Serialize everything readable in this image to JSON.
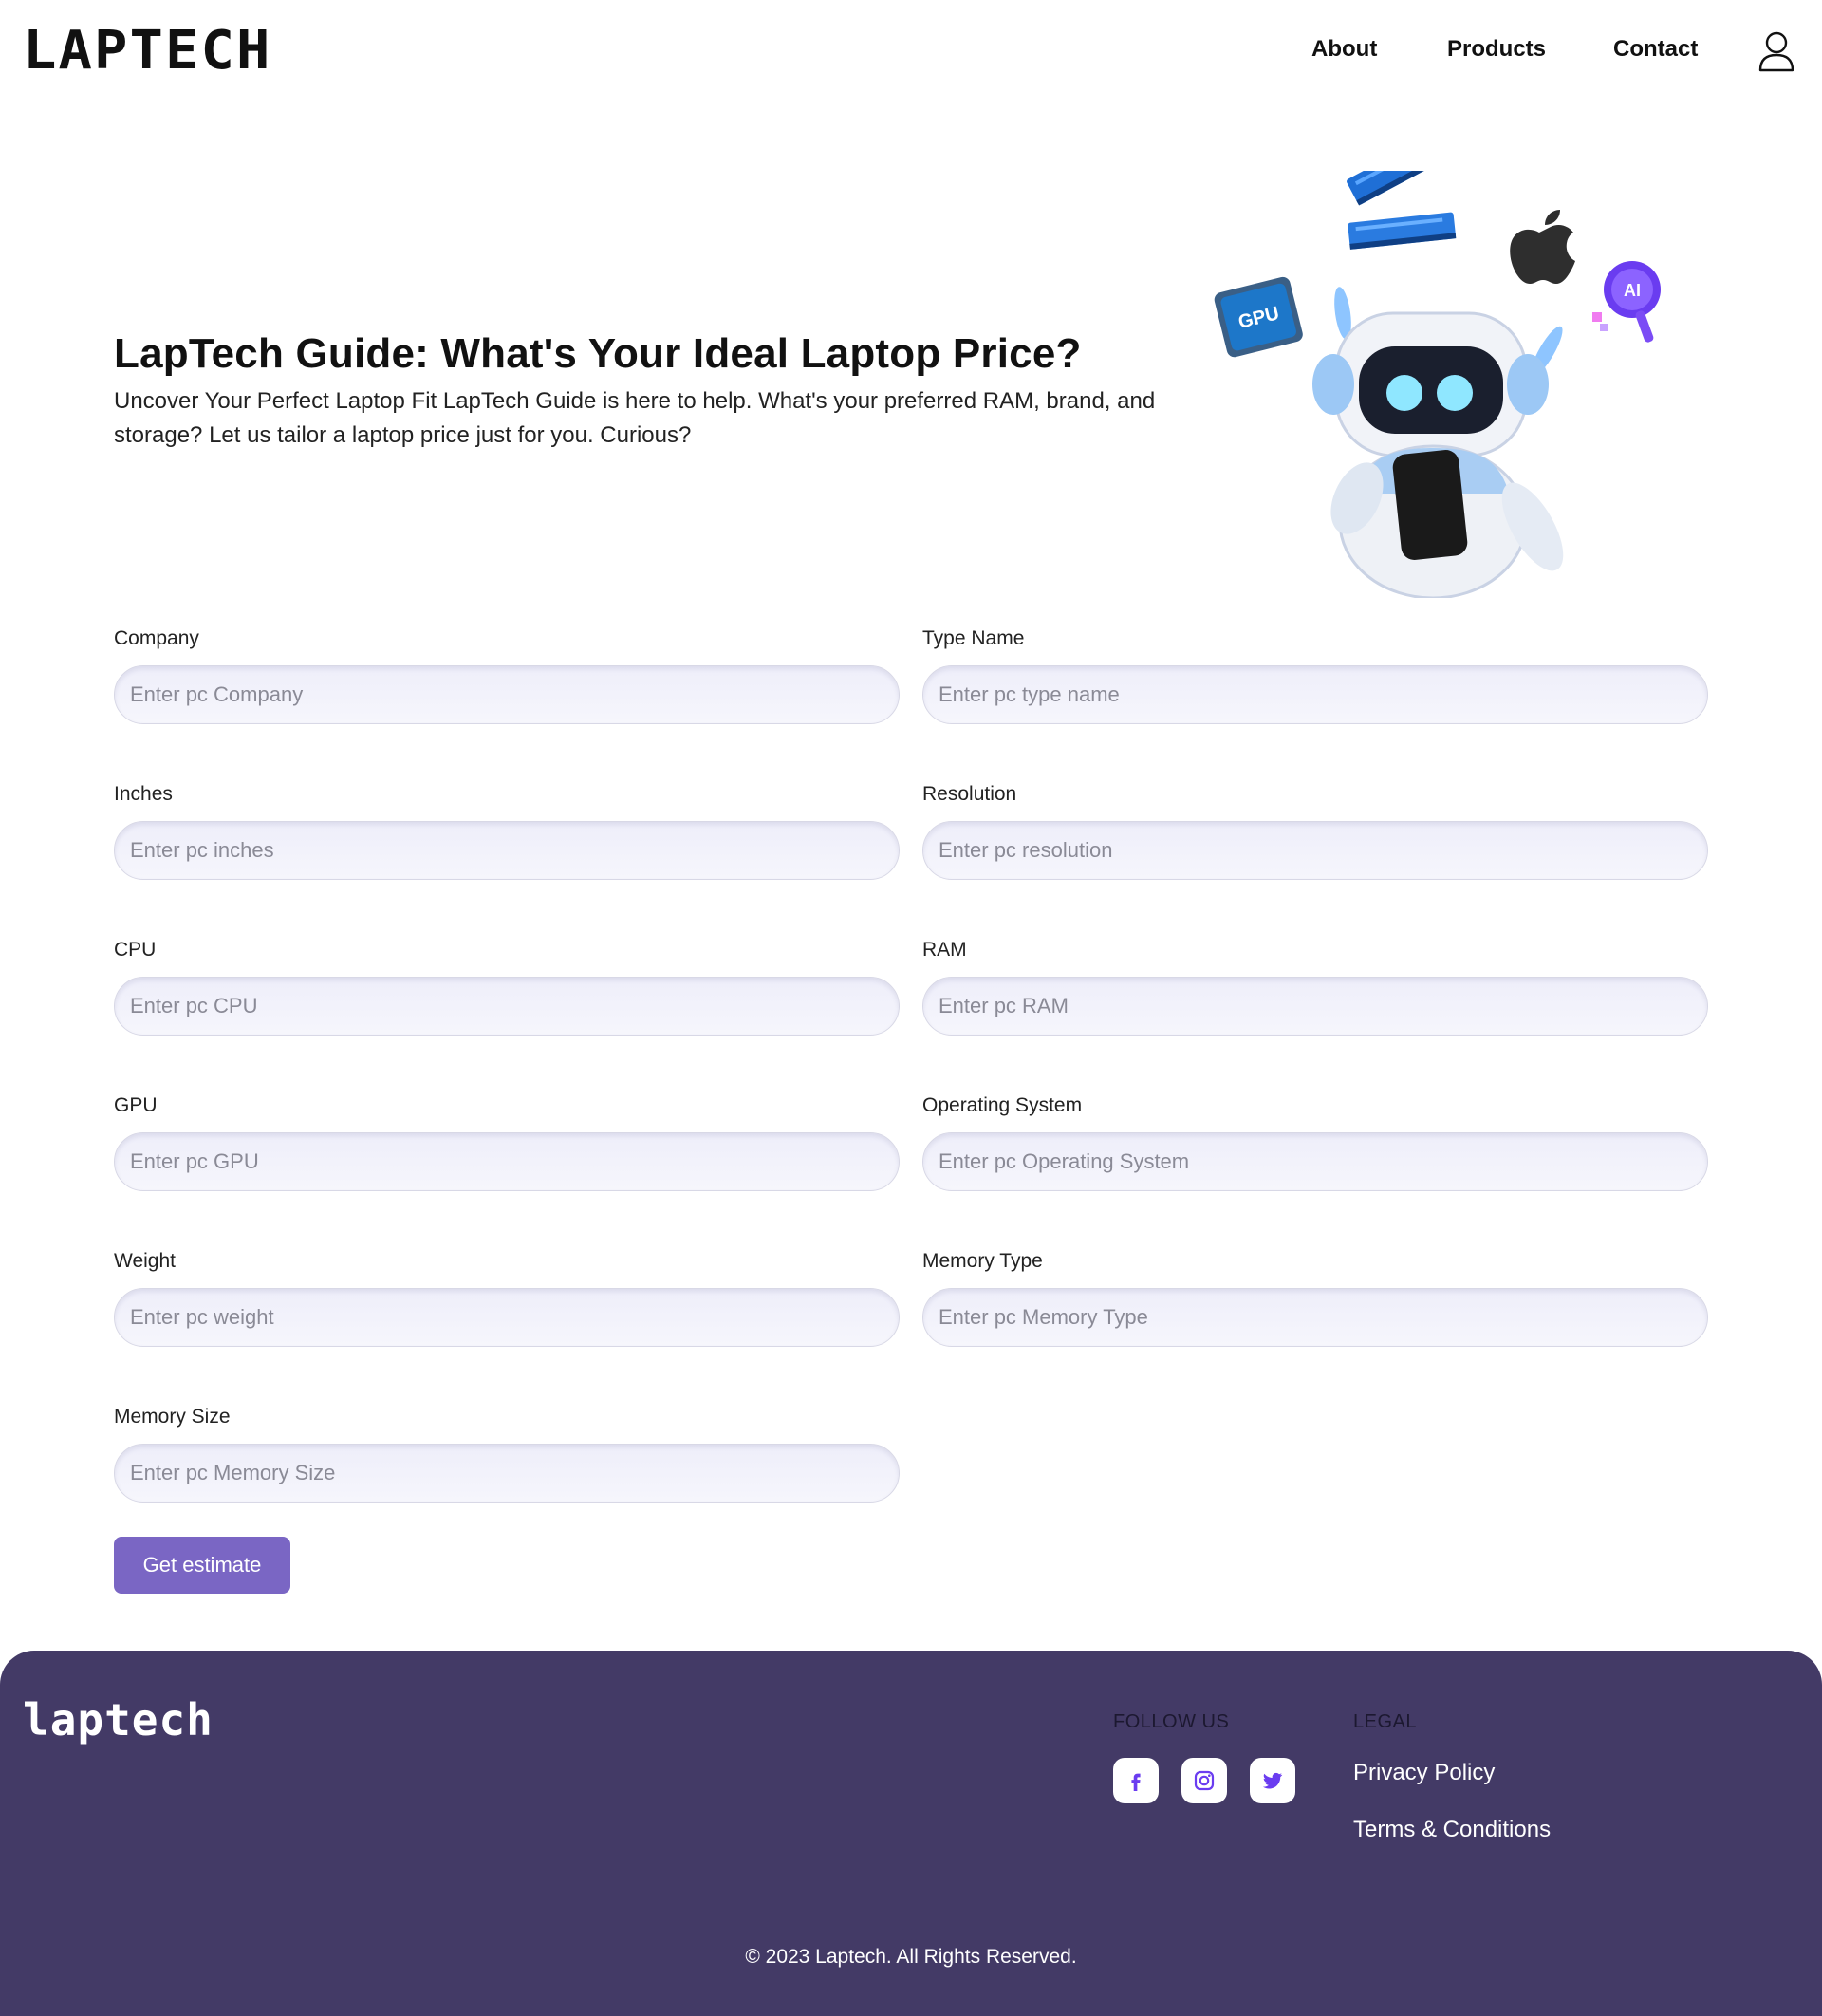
{
  "header": {
    "logo": "LAPTECH",
    "nav": [
      "About",
      "Products",
      "Contact"
    ],
    "user_icon": "user-icon"
  },
  "hero": {
    "title": "LapTech Guide: What's Your Ideal Laptop Price?",
    "text": "Uncover Your Perfect Laptop Fit LapTech Guide is here to help. What's your preferred RAM, brand, and storage? Let us tailor a laptop price just for you. Curious?",
    "illustration": {
      "gpu_chip_label": "GPU",
      "ai_badge_label": "AI"
    }
  },
  "form": {
    "fields": [
      {
        "label": "Company",
        "placeholder": "Enter pc Company"
      },
      {
        "label": "Type Name",
        "placeholder": "Enter pc type name"
      },
      {
        "label": "Inches",
        "placeholder": "Enter pc inches"
      },
      {
        "label": "Resolution",
        "placeholder": "Enter pc resolution"
      },
      {
        "label": "CPU",
        "placeholder": "Enter pc CPU"
      },
      {
        "label": "RAM",
        "placeholder": "Enter pc RAM"
      },
      {
        "label": "GPU",
        "placeholder": "Enter pc GPU"
      },
      {
        "label": "Operating System",
        "placeholder": "Enter pc Operating System"
      },
      {
        "label": "Weight",
        "placeholder": "Enter pc weight"
      },
      {
        "label": "Memory Type",
        "placeholder": "Enter pc Memory Type"
      },
      {
        "label": "Memory Size",
        "placeholder": "Enter pc Memory Size"
      }
    ],
    "submit_label": "Get estimate",
    "accent_color": "#7a66c4"
  },
  "footer": {
    "logo": "laptech",
    "follow_heading": "FOLLOW US",
    "social_icons": [
      "facebook-icon",
      "instagram-icon",
      "twitter-icon"
    ],
    "legal_heading": "LEGAL",
    "legal_links": [
      "Privacy Policy",
      "Terms & Conditions"
    ],
    "copyright": "© 2023 Laptech. All Rights Reserved.",
    "background_color": "#433a66"
  }
}
